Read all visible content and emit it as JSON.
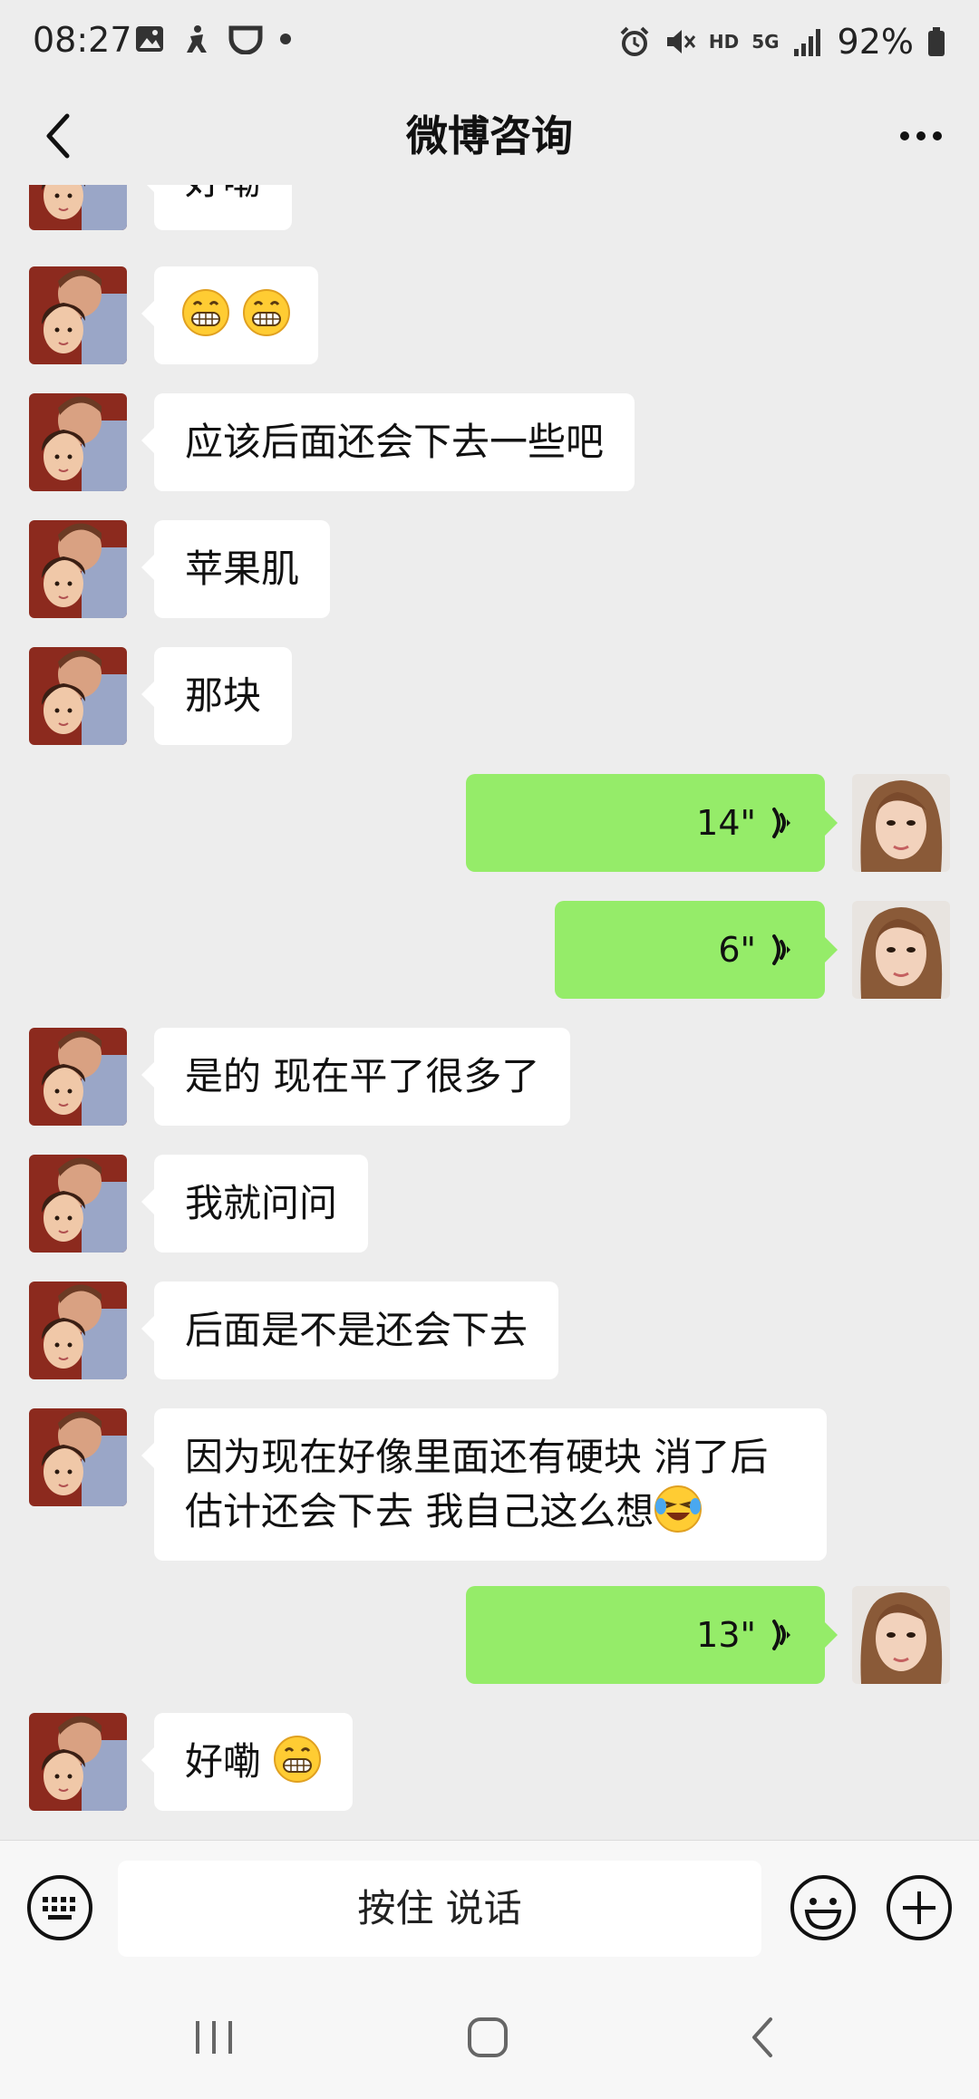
{
  "status_bar": {
    "time": "08:27",
    "battery": "92%",
    "net": "5G",
    "hd": "HD"
  },
  "header": {
    "title": "微博咨询"
  },
  "messages": [
    {
      "side": "left",
      "text": "好嘞"
    },
    {
      "side": "left",
      "text": "",
      "emoji": [
        "grin",
        "grin"
      ]
    },
    {
      "side": "left",
      "text": "应该后面还会下去一些吧"
    },
    {
      "side": "left",
      "text": "苹果肌"
    },
    {
      "side": "left",
      "text": "那块"
    },
    {
      "side": "right",
      "voice": "14\""
    },
    {
      "side": "right",
      "voice": "6\""
    },
    {
      "side": "left",
      "text": "是的 现在平了很多了"
    },
    {
      "side": "left",
      "text": "我就问问"
    },
    {
      "side": "left",
      "text": "后面是不是还会下去"
    },
    {
      "side": "left",
      "text_lines": [
        "因为现在好像里面还有硬块 消了后",
        "估计还会下去 我自己这么想"
      ],
      "trailing_emoji": "laugh-cry"
    },
    {
      "side": "right",
      "voice": "13\""
    },
    {
      "side": "left",
      "text": "好嘞",
      "trailing_emoji": "grin"
    }
  ],
  "input_bar": {
    "hold_to_talk": "按住 说话"
  },
  "colors": {
    "self_bubble": "#95ec69",
    "other_bubble": "#ffffff",
    "background": "#ededed"
  }
}
